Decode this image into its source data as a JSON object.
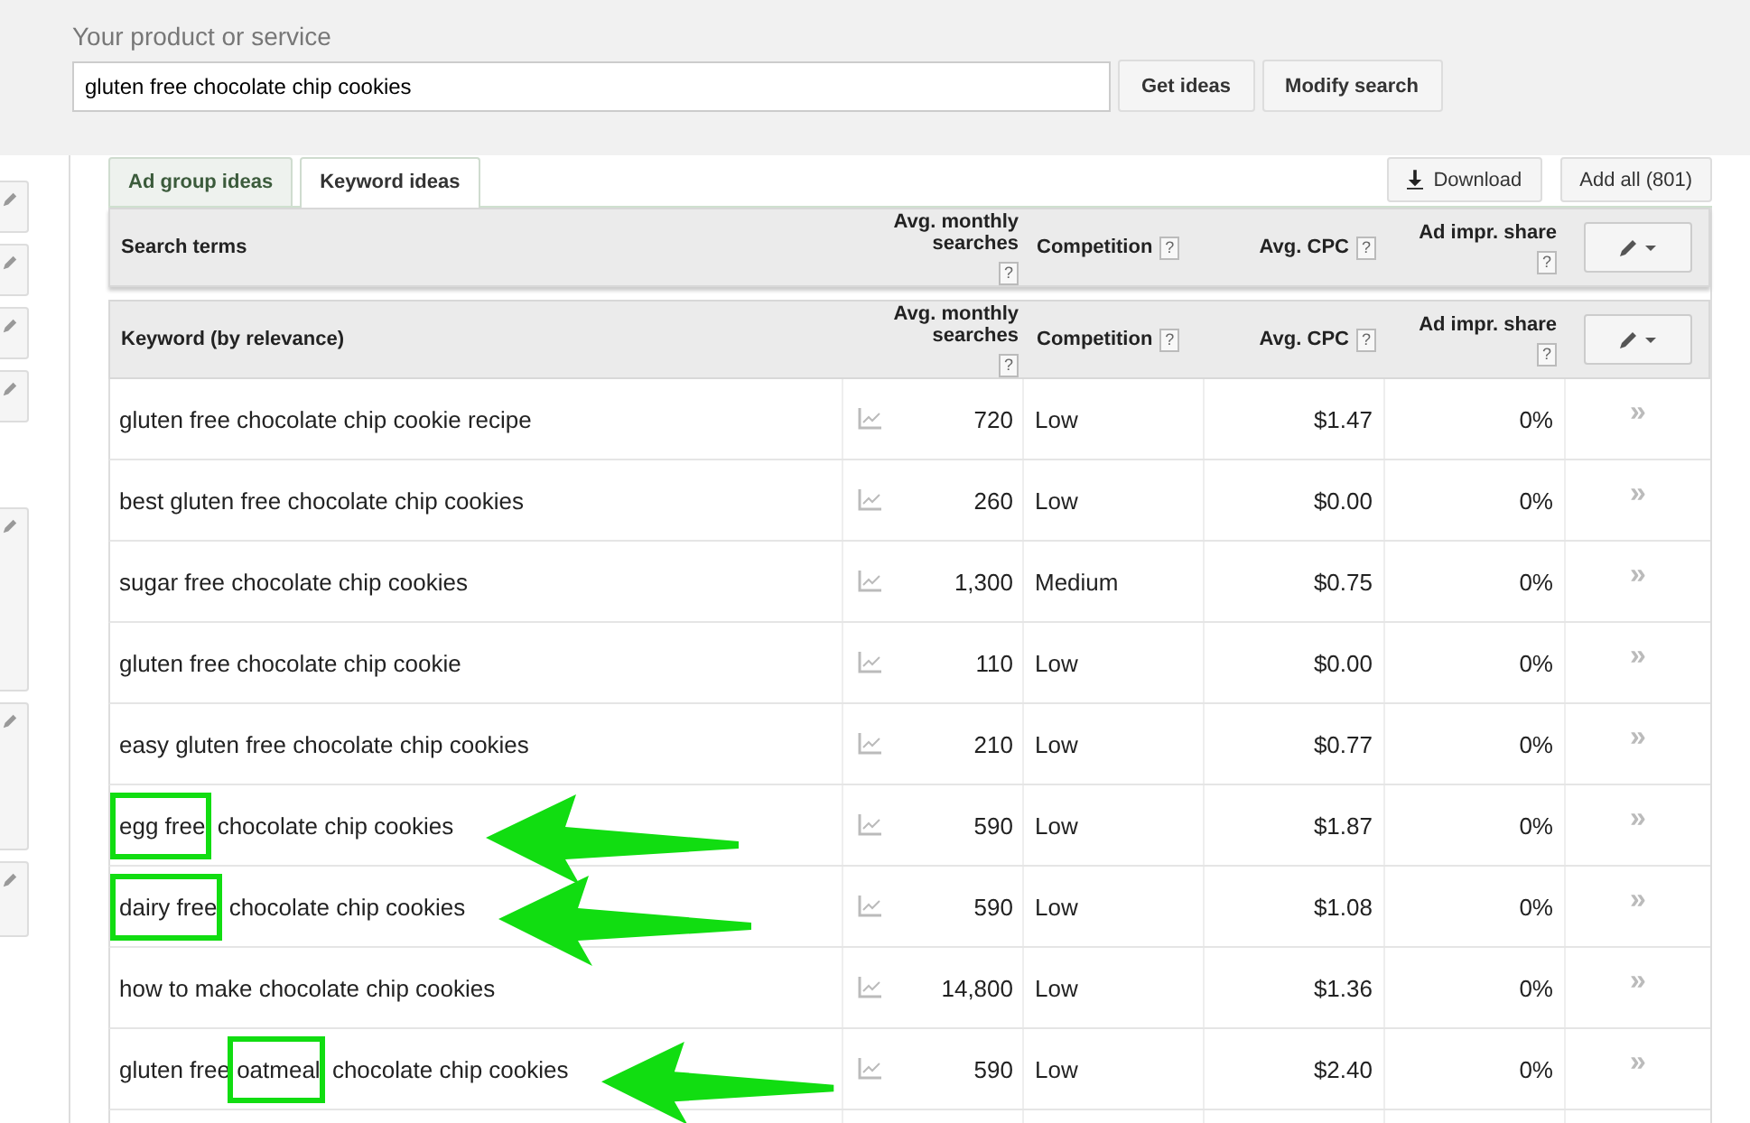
{
  "search": {
    "label": "Your product or service",
    "value": "gluten free chocolate chip cookies",
    "buttons": [
      "Get ideas",
      "Modify search"
    ]
  },
  "tabs": [
    {
      "label": "Ad group ideas",
      "selected": false
    },
    {
      "label": "Keyword ideas",
      "selected": true
    }
  ],
  "actions": {
    "download": "Download",
    "add_all": "Add all (801)"
  },
  "search_terms_header": {
    "columns": [
      {
        "label": "Search terms"
      },
      {
        "label": "Avg. monthly searches",
        "help": "?"
      },
      {
        "label": "Competition",
        "help": "?"
      },
      {
        "label": "Avg. CPC",
        "help": "?"
      },
      {
        "label": "Ad impr. share",
        "help": "?"
      }
    ]
  },
  "keyword_header": {
    "columns": [
      {
        "label": "Keyword (by relevance)"
      },
      {
        "label": "Avg. monthly searches",
        "help": "?"
      },
      {
        "label": "Competition",
        "help": "?"
      },
      {
        "label": "Avg. CPC",
        "help": "?"
      },
      {
        "label": "Ad impr. share",
        "help": "?"
      }
    ]
  },
  "rows": [
    {
      "keyword": [
        {
          "text": "gluten free chocolate chip cookie recipe",
          "boxed": false
        }
      ],
      "arrow": false,
      "searches": "720",
      "competition": "Low",
      "cpc": "$1.47",
      "share": "0%",
      "add": "»"
    },
    {
      "keyword": [
        {
          "text": "best gluten free chocolate chip cookies",
          "boxed": false
        }
      ],
      "arrow": false,
      "searches": "260",
      "competition": "Low",
      "cpc": "$0.00",
      "share": "0%",
      "add": "»"
    },
    {
      "keyword": [
        {
          "text": "sugar free chocolate chip cookies",
          "boxed": false
        }
      ],
      "arrow": false,
      "searches": "1,300",
      "competition": "Medium",
      "cpc": "$0.75",
      "share": "0%",
      "add": "»"
    },
    {
      "keyword": [
        {
          "text": "gluten free chocolate chip cookie",
          "boxed": false
        }
      ],
      "arrow": false,
      "searches": "110",
      "competition": "Low",
      "cpc": "$0.00",
      "share": "0%",
      "add": "»"
    },
    {
      "keyword": [
        {
          "text": "easy gluten free chocolate chip cookies",
          "boxed": false
        }
      ],
      "arrow": false,
      "searches": "210",
      "competition": "Low",
      "cpc": "$0.77",
      "share": "0%",
      "add": "»"
    },
    {
      "keyword": [
        {
          "text": "egg free",
          "boxed": true
        },
        {
          "text": "chocolate chip cookies",
          "boxed": false
        }
      ],
      "arrow": true,
      "searches": "590",
      "competition": "Low",
      "cpc": "$1.87",
      "share": "0%",
      "add": "»"
    },
    {
      "keyword": [
        {
          "text": "dairy free",
          "boxed": true
        },
        {
          "text": "chocolate chip cookies",
          "boxed": false
        }
      ],
      "arrow": true,
      "searches": "590",
      "competition": "Low",
      "cpc": "$1.08",
      "share": "0%",
      "add": "»"
    },
    {
      "keyword": [
        {
          "text": "how to make chocolate chip cookies",
          "boxed": false
        }
      ],
      "arrow": false,
      "searches": "14,800",
      "competition": "Low",
      "cpc": "$1.36",
      "share": "0%",
      "add": "»"
    },
    {
      "keyword": [
        {
          "text": "gluten free",
          "boxed": false
        },
        {
          "text": "oatmeal",
          "boxed": true
        },
        {
          "text": "chocolate chip cookies",
          "boxed": false
        }
      ],
      "arrow": true,
      "searches": "590",
      "competition": "Low",
      "cpc": "$2.40",
      "share": "0%",
      "add": "»"
    }
  ]
}
